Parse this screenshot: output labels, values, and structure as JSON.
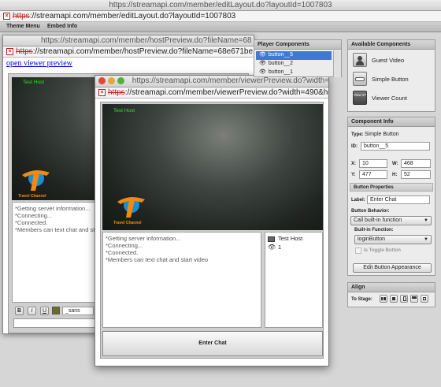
{
  "outer": {
    "title": "https://streamapi.com/member/editLayout.do?layoutId=1007803",
    "url_scheme": "https",
    "url_rest": "://streamapi.com/member/editLayout.do?layoutId=1007803",
    "tabs": [
      "Theme Menu",
      "Embed Info"
    ]
  },
  "host_window": {
    "title": "https://streamapi.com/member/hostPreview.do?fileName=68",
    "url_scheme": "https",
    "url_rest": "://streamapi.com/member/hostPreview.do?fileName=68e671be...",
    "link": "open viewer preview",
    "video_label": "Test Host",
    "logo_text": "Travel Channel",
    "chat_lines": [
      "*Getting server information...",
      "*Connecting...",
      "*Connected.",
      "*Members can text chat and start video"
    ],
    "format": {
      "bold": "B",
      "italic": "I",
      "underline": "U",
      "font": "_sans"
    }
  },
  "viewer_window": {
    "title": "https://streamapi.com/member/viewerPreview.do?width=490",
    "url_scheme": "https",
    "url_rest": "://streamapi.com/member/viewerPreview.do?width=490&height...",
    "video_label": "Test Host",
    "logo_text": "Travel Channel",
    "chat_lines": [
      "*Getting server information...",
      "*Connecting...",
      "*Connected.",
      "*Members can text chat and start video"
    ],
    "users": [
      {
        "name": "Test Host",
        "icon": "monitor-icon"
      },
      {
        "name": "1",
        "icon": "eye-icon"
      }
    ],
    "enter_chat": "Enter Chat"
  },
  "player_components": {
    "title": "Player Components",
    "items": [
      "button__5",
      "button__2",
      "button__1"
    ],
    "selected": 0
  },
  "available_components": {
    "title": "Available Components",
    "items": [
      {
        "label": "Guest Video",
        "icon": "guest-video-icon"
      },
      {
        "label": "Simple Button",
        "icon": "simple-button-icon"
      },
      {
        "label": "Viewer Count",
        "icon": "viewer-count-icon",
        "icon_text": "View 27"
      }
    ]
  },
  "component_info": {
    "title": "Component Info",
    "type_label": "Type:",
    "type_value": "Simple Button",
    "id_label": "ID:",
    "id_value": "button__5",
    "x_label": "X:",
    "x_value": "10",
    "w_label": "W:",
    "w_value": "468",
    "y_label": "Y:",
    "y_value": "477",
    "h_label": "H:",
    "h_value": "52",
    "props_title": "Button Properties",
    "label_label": "Label:",
    "label_value": "Enter Chat",
    "behavior_label": "Button Behavior:",
    "behavior_value": "Call built-in function",
    "builtin_label": "Built-in Function:",
    "builtin_value": "loginButton",
    "toggle_label": "Is Toggle Button",
    "edit_button": "Edit Button Appearance"
  },
  "align": {
    "title": "Align",
    "to_stage": "To Stage:"
  }
}
